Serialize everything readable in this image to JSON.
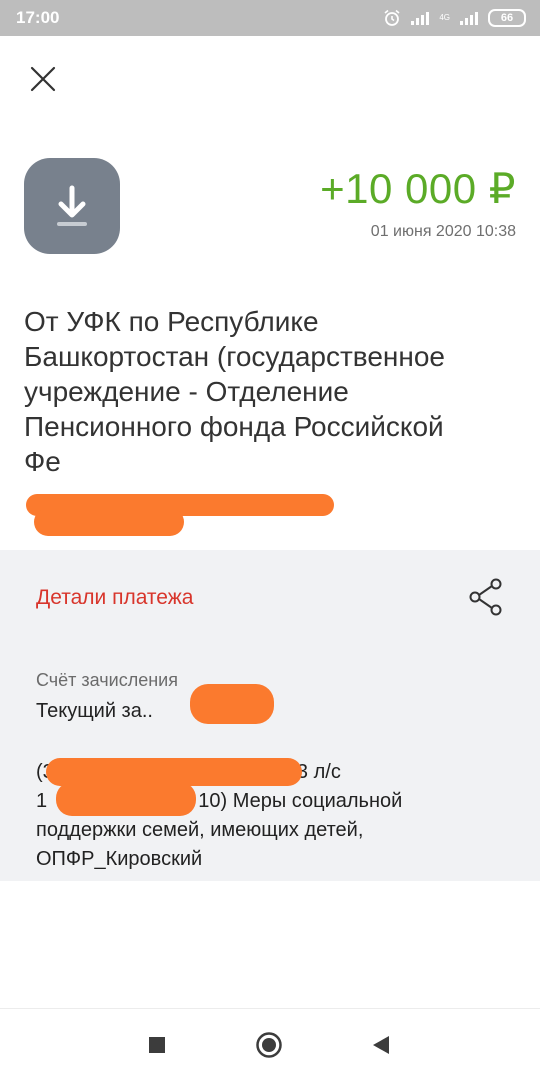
{
  "status_bar": {
    "time": "17:00",
    "network": "4G",
    "battery": "66"
  },
  "operation": {
    "amount": "+10 000 ₽",
    "datetime": "01 июня 2020 10:38",
    "payer_lines": [
      "От УФК по Республике",
      "Башкортостан (государственное",
      "учреждение - Отделение",
      "Пенсионного фонда Российской",
      "Фе"
    ],
    "icon": "download-icon",
    "amount_color": "#5bab27"
  },
  "details": {
    "title": "Детали платежа",
    "title_color": "#d8352b",
    "account_label": "Счёт зачисления",
    "account_value": "Текущий за..",
    "purpose_lines": [
      "(3",
      "3 л/с",
      "1",
      "10) Меры социальной",
      "поддержки семей, имеющих детей,",
      "ОПФР_Кировский"
    ]
  },
  "redaction_color": "#fb7a2e"
}
